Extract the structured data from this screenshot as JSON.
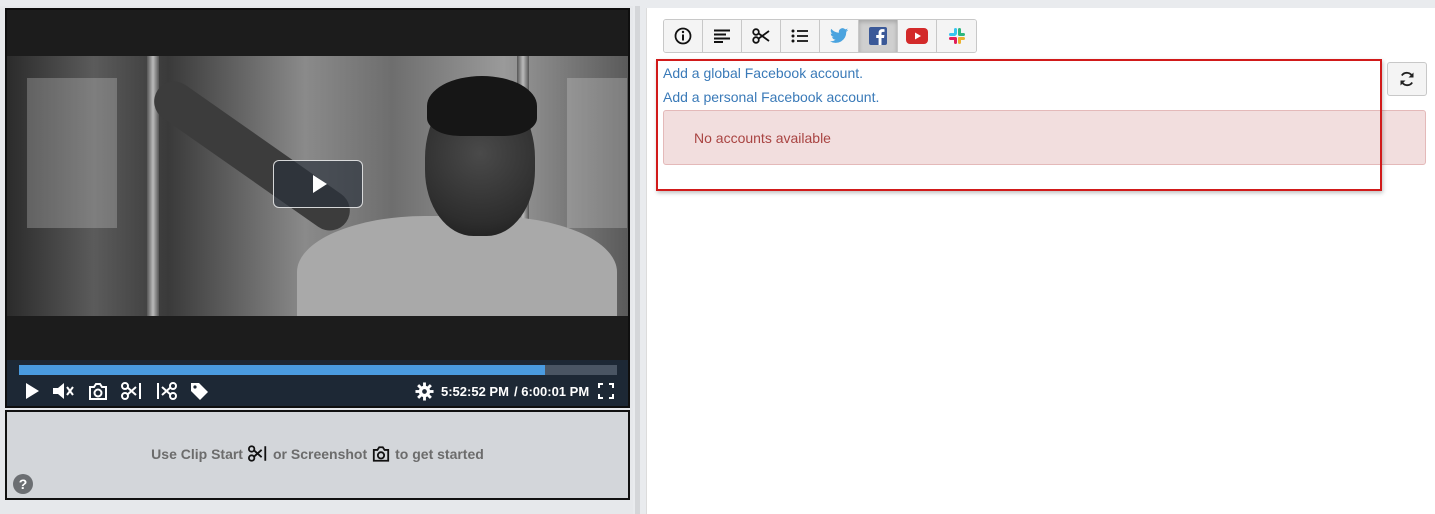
{
  "player": {
    "progress_fraction": 0.88,
    "current_time": "5:52:52 PM",
    "total_time": "/ 6:00:01 PM",
    "colors": {
      "progress_fill": "#4a9be0",
      "controls_bg": "#1d2835"
    }
  },
  "clip_panel": {
    "text_part1": "Use Clip Start",
    "text_part2": "or Screenshot",
    "text_part3": "to get started",
    "help_glyph": "?"
  },
  "toolbar": {
    "buttons": [
      {
        "icon": "info-icon"
      },
      {
        "icon": "text-align-icon"
      },
      {
        "icon": "scissors-icon"
      },
      {
        "icon": "list-icon"
      },
      {
        "icon": "twitter-icon",
        "color": "#4aa3df"
      },
      {
        "icon": "facebook-icon",
        "color": "#3b5998",
        "active": true
      },
      {
        "icon": "youtube-icon",
        "color": "#d32a2a"
      },
      {
        "icon": "slack-icon"
      }
    ]
  },
  "facebook": {
    "add_global": "Add a global Facebook account.",
    "add_personal": "Add a personal Facebook account.",
    "no_accounts": "No accounts available",
    "refresh_icon": "refresh-icon",
    "colors": {
      "link": "#3a7ab8",
      "alert_bg": "#f2dede",
      "alert_text": "#a94442",
      "highlight": "#d11a1a"
    }
  }
}
